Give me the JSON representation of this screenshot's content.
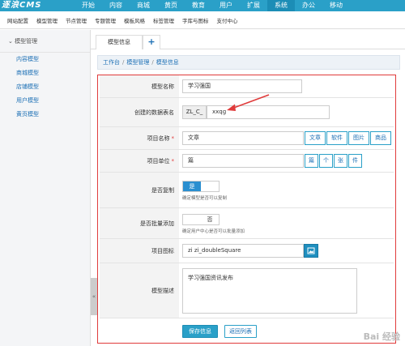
{
  "topbar": {
    "logo": "逐浪CMS",
    "items": [
      "开始",
      "内容",
      "商城",
      "黄页",
      "教育",
      "用户",
      "扩展",
      "系统",
      "办公",
      "移动"
    ],
    "active_index": 7
  },
  "subnav": {
    "items": [
      "网站配置",
      "模型管理",
      "节点管理",
      "专题管理",
      "模板风格",
      "标签管理",
      "字库与图标",
      "支付中心"
    ]
  },
  "sidebar": {
    "heading": "模型管理",
    "items": [
      "内容模型",
      "商城模型",
      "店铺模型",
      "用户模型",
      "黄页模型"
    ],
    "toggle": "«"
  },
  "tabs": {
    "active": "模型信息",
    "add": "+"
  },
  "breadcrumb": {
    "items": [
      "工作台",
      "模型管理",
      "模型信息"
    ],
    "separator": "/"
  },
  "form": {
    "model_name": {
      "label": "模型名称",
      "value": "学习强国"
    },
    "table_name": {
      "label": "创建的数据表名",
      "prefix": "ZL_C_",
      "value": "xxqg"
    },
    "item_name": {
      "label": "项目名称",
      "required": "*",
      "value": "文章",
      "options": [
        "文章",
        "软件",
        "图片",
        "商品"
      ]
    },
    "item_unit": {
      "label": "项目单位",
      "required": "*",
      "value": "篇",
      "options": [
        "篇",
        "个",
        "张",
        "件"
      ]
    },
    "copy": {
      "label": "是否复制",
      "toggle_on": "是",
      "hint": "确定模型是否可以复制"
    },
    "batch_add": {
      "label": "是否批量添加",
      "toggle_off": "否",
      "hint": "确定用户中心是否可以批量添加"
    },
    "icon": {
      "label": "项目图标",
      "value": "zi zi_doubleSquare"
    },
    "description": {
      "label": "模型描述",
      "value": "学习强国资讯发布"
    },
    "buttons": {
      "save": "保存信息",
      "back": "返回列表"
    }
  },
  "colors": {
    "brand": "#2aa0c8",
    "highlight_border": "#e03b3b",
    "link": "#1b6fb5"
  },
  "watermark": "Bai 经验"
}
